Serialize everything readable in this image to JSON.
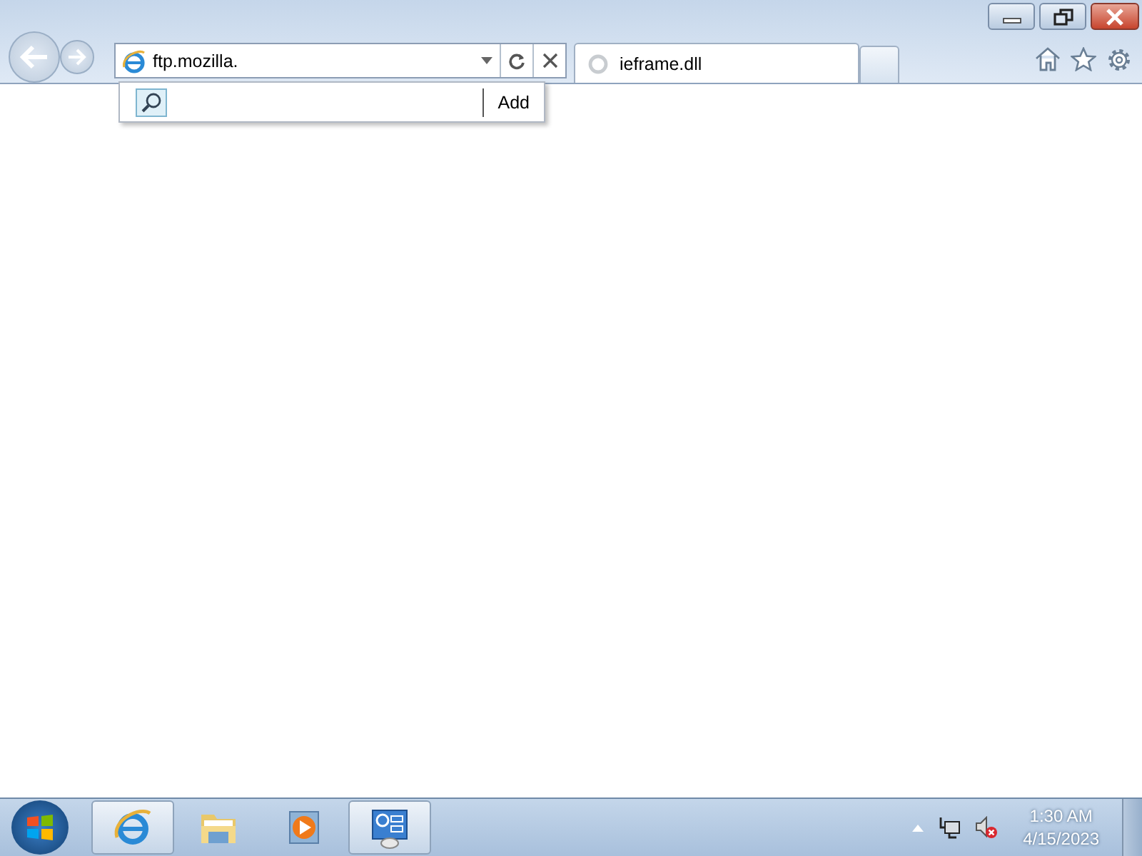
{
  "address_bar": {
    "value": "ftp.mozilla."
  },
  "suggestion_dropdown": {
    "button": "Add"
  },
  "tabs": [
    {
      "label": "ieframe.dll",
      "selected": true,
      "loading": true
    }
  ],
  "taskbar": {
    "items": [
      {
        "kind": "browser",
        "active": true
      },
      {
        "kind": "folder",
        "active": false
      },
      {
        "kind": "media",
        "active": false
      },
      {
        "kind": "control-panel",
        "active": true
      }
    ]
  },
  "clock": {
    "time": "1:30 AM",
    "date": "4/15/2023"
  }
}
